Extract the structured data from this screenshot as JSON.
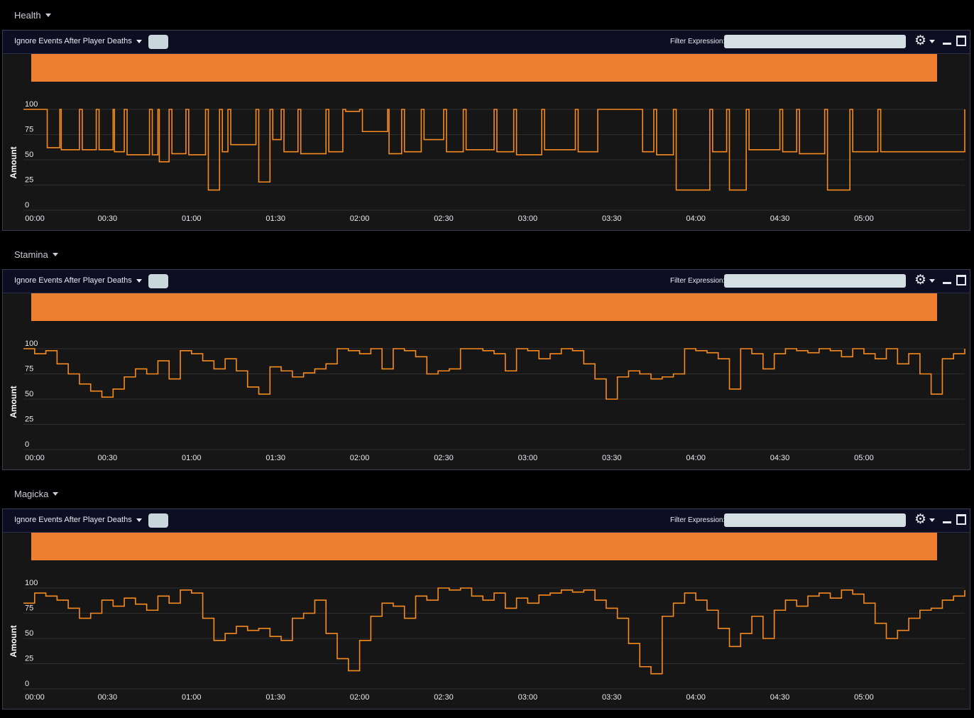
{
  "colors": {
    "accent": "#ee7f31",
    "line": "#f78a1e",
    "panel_bg": "#161616",
    "toolbar_bg": "#0d0e22"
  },
  "panels": [
    {
      "title": "Health",
      "ignore_label": "Ignore Events After Player Deaths",
      "filter_label": "Filter Expression:",
      "filter_value": "",
      "icons": [
        "gear-icon",
        "minimize-icon",
        "maximize-icon"
      ]
    },
    {
      "title": "Stamina",
      "ignore_label": "Ignore Events After Player Deaths",
      "filter_label": "Filter Expression:",
      "filter_value": "",
      "icons": [
        "gear-icon",
        "minimize-icon",
        "maximize-icon"
      ]
    },
    {
      "title": "Magicka",
      "ignore_label": "Ignore Events After Player Deaths",
      "filter_label": "Filter Expression:",
      "filter_value": "",
      "icons": [
        "gear-icon",
        "minimize-icon",
        "maximize-icon"
      ]
    }
  ],
  "chart_data": [
    {
      "type": "line",
      "title": "Health",
      "ylabel": "Amount",
      "xlabel": "",
      "y_ticks": [
        "0",
        "25",
        "50",
        "75",
        "100"
      ],
      "ylim": [
        0,
        100
      ],
      "grid": true,
      "x_ticks": [
        "00:00",
        "00:30",
        "01:00",
        "01:30",
        "02:00",
        "02:30",
        "03:00",
        "03:30",
        "04:00",
        "04:30",
        "05:00"
      ],
      "xlim": [
        "00:00",
        "05:36"
      ],
      "x_unit": "mm:ss",
      "series": [
        {
          "name": "",
          "x": [
            "00:00",
            "00:08",
            "00:08.5",
            "00:13",
            "00:13.5",
            "00:20",
            "00:21",
            "00:26",
            "00:27",
            "00:32",
            "00:32.5",
            "00:36",
            "00:37",
            "00:45",
            "00:46",
            "00:48",
            "00:48.5",
            "00:52",
            "00:53",
            "00:58",
            "00:59",
            "01:05",
            "01:06",
            "01:10",
            "01:11",
            "01:13",
            "01:14",
            "01:23",
            "01:24",
            "01:28",
            "01:29",
            "01:32",
            "01:33",
            "01:38",
            "01:39",
            "01:48",
            "01:49",
            "01:54",
            "01:55",
            "02:00",
            "02:01",
            "02:10",
            "02:10.5",
            "02:15",
            "02:16",
            "02:22",
            "02:23",
            "02:30",
            "02:31",
            "02:37",
            "02:38",
            "02:48",
            "02:49",
            "02:55",
            "02:56",
            "03:05",
            "03:06",
            "03:17",
            "03:18",
            "03:25",
            "03:26",
            "03:40",
            "03:41",
            "03:45",
            "03:46",
            "03:52",
            "03:53",
            "04:05",
            "04:06",
            "04:11",
            "04:12",
            "04:18",
            "04:19",
            "04:30",
            "04:31",
            "04:36",
            "04:37",
            "04:46",
            "04:47",
            "04:55",
            "04:56",
            "05:05",
            "05:06",
            "05:36"
          ],
          "y": [
            100,
            100,
            62,
            100,
            60,
            100,
            60,
            100,
            60,
            100,
            58,
            100,
            55,
            100,
            55,
            100,
            48,
            100,
            56,
            100,
            55,
            100,
            20,
            100,
            58,
            100,
            65,
            100,
            28,
            100,
            70,
            100,
            58,
            100,
            56,
            100,
            58,
            100,
            98,
            100,
            78,
            100,
            56,
            100,
            58,
            100,
            70,
            100,
            58,
            100,
            60,
            100,
            58,
            100,
            55,
            100,
            60,
            100,
            58,
            100,
            100,
            100,
            58,
            100,
            55,
            100,
            20,
            100,
            58,
            100,
            20,
            100,
            60,
            100,
            58,
            100,
            56,
            100,
            20,
            100,
            58,
            100,
            58,
            100
          ]
        }
      ]
    },
    {
      "type": "line",
      "title": "Stamina",
      "ylabel": "Amount",
      "xlabel": "",
      "y_ticks": [
        "0",
        "25",
        "50",
        "75",
        "100"
      ],
      "ylim": [
        0,
        100
      ],
      "grid": true,
      "x_ticks": [
        "00:00",
        "00:30",
        "01:00",
        "01:30",
        "02:00",
        "02:30",
        "03:00",
        "03:30",
        "04:00",
        "04:30",
        "05:00"
      ],
      "xlim": [
        "00:00",
        "05:36"
      ],
      "x_unit": "mm:ss",
      "series": [
        {
          "name": "",
          "x": [
            "00:00",
            "00:04",
            "00:08",
            "00:12",
            "00:16",
            "00:20",
            "00:24",
            "00:28",
            "00:32",
            "00:36",
            "00:40",
            "00:44",
            "00:48",
            "00:52",
            "00:56",
            "01:00",
            "01:04",
            "01:08",
            "01:12",
            "01:16",
            "01:20",
            "01:24",
            "01:28",
            "01:32",
            "01:36",
            "01:40",
            "01:44",
            "01:48",
            "01:52",
            "01:56",
            "02:00",
            "02:04",
            "02:08",
            "02:12",
            "02:16",
            "02:20",
            "02:24",
            "02:28",
            "02:32",
            "02:36",
            "02:40",
            "02:44",
            "02:48",
            "02:52",
            "02:56",
            "03:00",
            "03:04",
            "03:08",
            "03:12",
            "03:16",
            "03:20",
            "03:24",
            "03:28",
            "03:32",
            "03:36",
            "03:40",
            "03:44",
            "03:48",
            "03:52",
            "03:56",
            "04:00",
            "04:04",
            "04:08",
            "04:12",
            "04:16",
            "04:20",
            "04:24",
            "04:28",
            "04:32",
            "04:36",
            "04:40",
            "04:44",
            "04:48",
            "04:52",
            "04:56",
            "05:00",
            "05:04",
            "05:08",
            "05:12",
            "05:16",
            "05:20",
            "05:24",
            "05:28",
            "05:32",
            "05:36"
          ],
          "y": [
            100,
            95,
            98,
            85,
            75,
            65,
            58,
            52,
            60,
            72,
            80,
            75,
            88,
            70,
            98,
            95,
            88,
            80,
            90,
            78,
            62,
            55,
            82,
            78,
            72,
            76,
            80,
            85,
            100,
            98,
            95,
            100,
            80,
            100,
            98,
            92,
            75,
            78,
            80,
            100,
            100,
            98,
            95,
            78,
            100,
            98,
            90,
            95,
            100,
            98,
            85,
            70,
            50,
            72,
            78,
            75,
            70,
            72,
            75,
            100,
            98,
            96,
            90,
            60,
            100,
            95,
            80,
            95,
            100,
            98,
            96,
            100,
            98,
            92,
            100,
            95,
            90,
            100,
            85,
            95,
            75,
            55,
            90,
            95,
            100
          ]
        }
      ]
    },
    {
      "type": "line",
      "title": "Magicka",
      "ylabel": "Amount",
      "xlabel": "",
      "y_ticks": [
        "0",
        "25",
        "50",
        "75",
        "100"
      ],
      "ylim": [
        0,
        100
      ],
      "grid": true,
      "x_ticks": [
        "00:00",
        "00:30",
        "01:00",
        "01:30",
        "02:00",
        "02:30",
        "03:00",
        "03:30",
        "04:00",
        "04:30",
        "05:00"
      ],
      "xlim": [
        "00:00",
        "05:36"
      ],
      "x_unit": "mm:ss",
      "series": [
        {
          "name": "",
          "x": [
            "00:00",
            "00:04",
            "00:08",
            "00:12",
            "00:16",
            "00:20",
            "00:24",
            "00:28",
            "00:32",
            "00:36",
            "00:40",
            "00:44",
            "00:48",
            "00:52",
            "00:56",
            "01:00",
            "01:04",
            "01:08",
            "01:12",
            "01:16",
            "01:20",
            "01:24",
            "01:28",
            "01:32",
            "01:36",
            "01:40",
            "01:44",
            "01:48",
            "01:52",
            "01:56",
            "02:00",
            "02:04",
            "02:08",
            "02:12",
            "02:16",
            "02:20",
            "02:24",
            "02:28",
            "02:32",
            "02:36",
            "02:40",
            "02:44",
            "02:48",
            "02:52",
            "02:56",
            "03:00",
            "03:04",
            "03:08",
            "03:12",
            "03:16",
            "03:20",
            "03:24",
            "03:28",
            "03:32",
            "03:36",
            "03:40",
            "03:44",
            "03:48",
            "03:52",
            "03:56",
            "04:00",
            "04:04",
            "04:08",
            "04:12",
            "04:16",
            "04:20",
            "04:24",
            "04:28",
            "04:32",
            "04:36",
            "04:40",
            "04:44",
            "04:48",
            "04:52",
            "04:56",
            "05:00",
            "05:04",
            "05:08",
            "05:12",
            "05:16",
            "05:20",
            "05:24",
            "05:28",
            "05:32",
            "05:36"
          ],
          "y": [
            85,
            95,
            92,
            88,
            80,
            70,
            75,
            88,
            82,
            90,
            84,
            78,
            92,
            85,
            98,
            95,
            70,
            48,
            55,
            62,
            58,
            60,
            52,
            48,
            70,
            75,
            88,
            55,
            30,
            18,
            48,
            72,
            85,
            82,
            70,
            92,
            88,
            100,
            98,
            100,
            92,
            88,
            95,
            80,
            90,
            85,
            93,
            95,
            98,
            96,
            98,
            88,
            80,
            70,
            45,
            22,
            15,
            72,
            85,
            95,
            88,
            78,
            60,
            42,
            55,
            72,
            50,
            78,
            88,
            82,
            92,
            95,
            90,
            98,
            94,
            85,
            65,
            50,
            58,
            70,
            78,
            80,
            88,
            92,
            98
          ]
        }
      ]
    }
  ]
}
